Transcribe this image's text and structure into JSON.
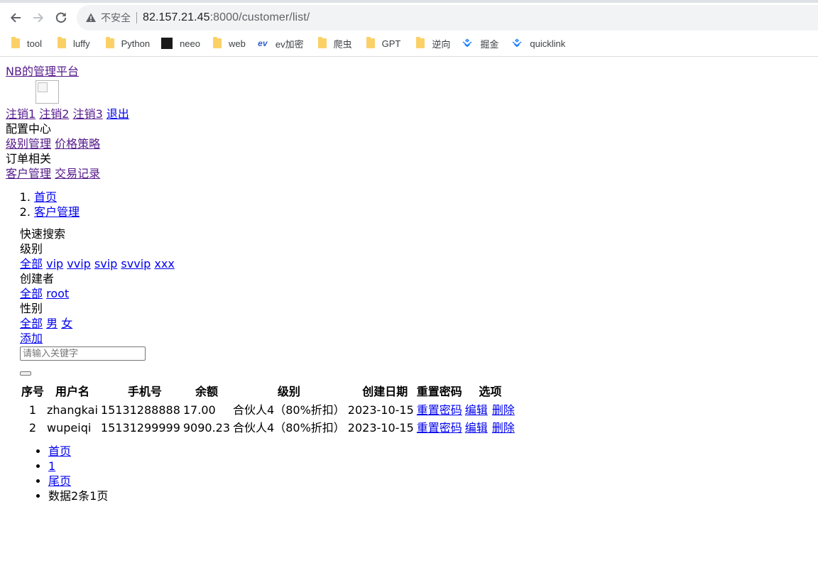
{
  "browser": {
    "insecure_label": "不安全",
    "url_host": "82.157.21.45",
    "url_rest": ":8000/customer/list/",
    "bookmarks": [
      "tool",
      "luffy",
      "Python",
      "neeo",
      "web",
      "ev加密",
      "爬虫",
      "GPT",
      "逆向",
      "掘金",
      "quicklink"
    ],
    "colors": {
      "folder": "#fbd167",
      "link": "#0000ee",
      "visited_link": "#551a8b"
    }
  },
  "page": {
    "brand": "NB的管理平台",
    "top_links": [
      "注销1",
      "注销2",
      "注销3",
      "退出"
    ],
    "menu": [
      {
        "title": "配置中心",
        "links": [
          "级别管理",
          "价格策略"
        ]
      },
      {
        "title": "订单相关",
        "links": [
          "客户管理",
          "交易记录"
        ]
      }
    ],
    "breadcrumb": [
      "首页",
      "客户管理"
    ],
    "filter": {
      "heading": "快速搜索",
      "groups": [
        {
          "label": "级别",
          "options": [
            "全部",
            "vip",
            "vvip",
            "svip",
            "svvip",
            "xxx"
          ]
        },
        {
          "label": "创建者",
          "options": [
            "全部",
            "root"
          ]
        },
        {
          "label": "性别",
          "options": [
            "全部",
            "男",
            "女"
          ]
        }
      ],
      "add_link": "添加",
      "search_placeholder": "请输入关键字"
    },
    "table": {
      "headers": [
        "序号",
        "用户名",
        "手机号",
        "余额",
        "级别",
        "创建日期",
        "重置密码",
        "选项"
      ],
      "rows": [
        {
          "id": "1",
          "username": "zhangkai",
          "phone": "15131288888",
          "balance": "17.00",
          "level": "合伙人4（80%折扣）",
          "created": "2023-10-15",
          "reset": "重置密码",
          "edit": "编辑",
          "delete": "删除"
        },
        {
          "id": "2",
          "username": "wupeiqi",
          "phone": "15131299999",
          "balance": "9090.23",
          "level": "合伙人4（80%折扣）",
          "created": "2023-10-15",
          "reset": "重置密码",
          "edit": "编辑",
          "delete": "删除"
        }
      ]
    },
    "pager": {
      "first": "首页",
      "page": "1",
      "last": "尾页",
      "summary": "数据2条1页"
    }
  }
}
